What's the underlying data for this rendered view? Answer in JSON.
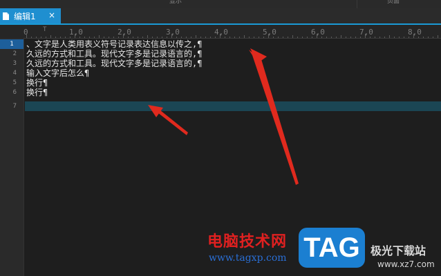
{
  "top_strip": {
    "left_text": "显示",
    "right_text": "页面"
  },
  "tab": {
    "label": "编辑1",
    "close": "×",
    "doc_icon": "document-icon"
  },
  "ruler": {
    "labels": [
      "0",
      "T",
      "1,0",
      "2,0",
      "3,0",
      "4,0",
      "5,0",
      "6,0",
      "7,0",
      "8,0"
    ]
  },
  "gutter": {
    "line_numbers": [
      "1",
      "2",
      "3",
      "4",
      "5",
      "6",
      "7"
    ],
    "current_line": "1"
  },
  "editor": {
    "lines": [
      "、文字是人类用表义符号记录表达信息以传之,¶",
      "久远的方式和工具。现代文字多是记录语言的,¶",
      "久远的方式和工具。现代文字多是记录语言的,¶",
      "输入文字后怎么¶",
      "换行¶",
      "换行¶",
      ""
    ],
    "highlighted_line": 7
  },
  "annotations": {
    "arrow_color": "#e02a1e"
  },
  "watermark": {
    "cn_text": "电脑技术网",
    "url": "www.tagxp.com",
    "badge": "TAG",
    "site": "极光下载站",
    "site_url": "www.xz7.com"
  },
  "colors": {
    "accent": "#1f8fd0",
    "current_line_bg": "#1b4654",
    "editor_bg": "#1e1e1e"
  }
}
